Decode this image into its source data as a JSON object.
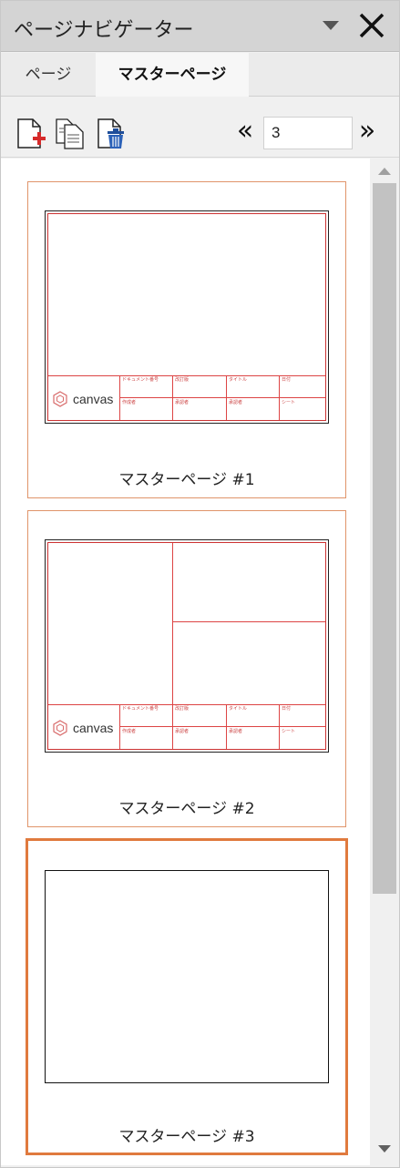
{
  "window": {
    "title": "ページナビゲーター",
    "menu_icon": "dropdown-triangle-icon",
    "close_icon": "close-x-icon"
  },
  "tabs": [
    {
      "label": "ページ",
      "active": false
    },
    {
      "label": "マスターページ",
      "active": true
    }
  ],
  "toolbar": {
    "add_icon": "add-page-icon",
    "duplicate_icon": "duplicate-page-icon",
    "delete_icon": "delete-page-icon",
    "prev_symbol": "«",
    "next_symbol": "»",
    "page_number": "3"
  },
  "thumbnail_title_block": {
    "logo_text": "canvas",
    "fields": [
      "ドキュメント番号",
      "改訂版",
      "タイトル",
      "日付",
      "作成者",
      "承認者",
      "承認者",
      "シート"
    ]
  },
  "master_pages": [
    {
      "label": "マスターページ #1",
      "layout": "title-block",
      "selected": false
    },
    {
      "label": "マスターページ #2",
      "layout": "split-with-title-block",
      "selected": false
    },
    {
      "label": "マスターページ #3",
      "layout": "blank",
      "selected": true
    }
  ],
  "colors": {
    "accent": "#e07a3e",
    "frame_red": "#dd4444",
    "titlebar": "#d4d4d4"
  }
}
